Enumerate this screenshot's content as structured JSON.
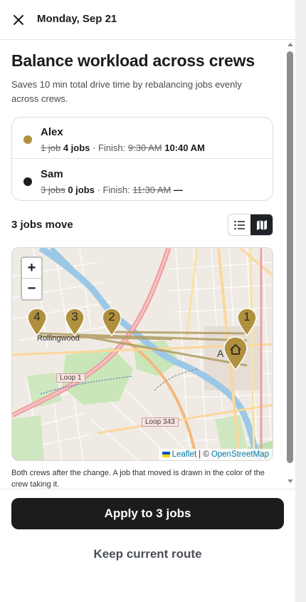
{
  "header": {
    "date": "Monday, Sep 21",
    "close_icon": "close-icon"
  },
  "suggestion": {
    "title": "Balance workload across crews",
    "description": "Saves 10 min total drive time by rebalancing jobs evenly across crews."
  },
  "crews": [
    {
      "name": "Alex",
      "color": "#b08f3e",
      "old_jobs": "1 job",
      "new_jobs": "4 jobs",
      "finish_label": "· Finish:",
      "old_finish": "9:30 AM",
      "new_finish": "10:40 AM"
    },
    {
      "name": "Sam",
      "color": "#1c1c1e",
      "old_jobs": "3 jobs",
      "new_jobs": "0 jobs",
      "finish_label": "· Finish:",
      "old_finish": "11:30 AM",
      "new_finish": "—"
    }
  ],
  "moves": {
    "label": "3 jobs move",
    "view_toggle": {
      "list_icon": "list-icon",
      "map_icon": "map-icon",
      "active": "map"
    }
  },
  "map": {
    "zoom_in": "+",
    "zoom_out": "−",
    "attribution": {
      "leaflet": "Leaflet",
      "separator": "| ©",
      "osm": "OpenStreetMap"
    },
    "road_labels": [
      "Loop 1",
      "Loop 343"
    ],
    "place_labels": [
      "Rollingwood",
      "A"
    ],
    "pins": [
      {
        "number": "4",
        "color": "#b08f3e"
      },
      {
        "number": "3",
        "color": "#b08f3e"
      },
      {
        "number": "2",
        "color": "#b08f3e"
      },
      {
        "number": "1",
        "color": "#b08f3e"
      }
    ],
    "home_pin_icon": "home-icon",
    "route_color": "#b09c63"
  },
  "caption": "Both crews after the change. A job that moved is drawn in the color of the crew taking it.",
  "actions": {
    "apply": "Apply to 3 jobs",
    "keep": "Keep current route"
  }
}
